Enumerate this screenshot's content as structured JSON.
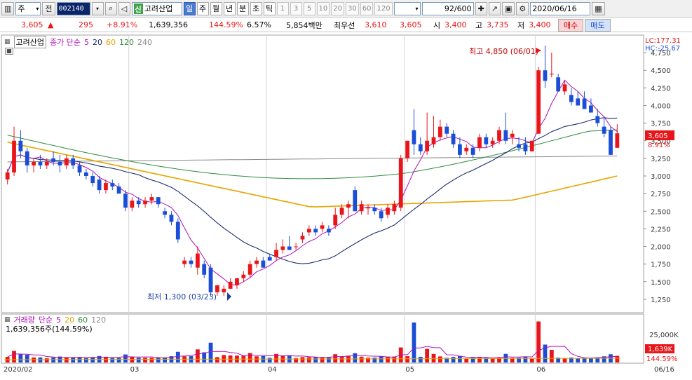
{
  "toolbar": {
    "market_a": "주",
    "market_b": "전",
    "code": "002140",
    "stock_name": "고려산업",
    "sin_badge": "신",
    "periods": [
      "일",
      "주",
      "월",
      "년",
      "분",
      "초",
      "틱"
    ],
    "active_period": "일",
    "numbers": [
      "1",
      "3",
      "5",
      "10",
      "20",
      "30",
      "60",
      "120"
    ],
    "count": "92/600",
    "date": "2020/06/16"
  },
  "quote": {
    "price": "3,605",
    "change_arrow": "▲",
    "change": "295",
    "change_pct": "+8.91%",
    "volume": "1,639,356",
    "volume_ratio": "144.59%",
    "turnover": "6.57%",
    "amount": "5,854백만",
    "best_ask_label": "최우선",
    "best_ask": "3,610",
    "best_bid": "3,605",
    "open_label": "시",
    "open": "3,400",
    "high_label": "고",
    "high": "3,735",
    "low_label": "저",
    "low": "3,400",
    "buy_label": "매수",
    "sell_label": "매도"
  },
  "price_panel": {
    "name": "고려산업",
    "ma_label": "종가 단순",
    "ma_periods": [
      "5",
      "20",
      "60",
      "120",
      "240"
    ],
    "lc": "LC:177.31",
    "hc": "HC:-25.67",
    "high_annot": "최고 4,850 (06/01)",
    "low_annot": "최저 1,300 (03/23)",
    "price_tag": "3,605",
    "pct_tag": "8.91%",
    "y_ticks": [
      "4,750",
      "4,500",
      "4,250",
      "4,000",
      "3,750",
      "3,500",
      "3,250",
      "3,000",
      "2,750",
      "2,500",
      "2,250",
      "2,000",
      "1,750",
      "1,500",
      "1,250"
    ]
  },
  "volume_panel": {
    "name": "거래량",
    "ma_label": "단순",
    "ma_periods": [
      "5",
      "20",
      "60",
      "120"
    ],
    "info": "1,639,356주(144.59%)",
    "y_tick": "25,000K",
    "vol_tag": "1,639K",
    "pct_tag": "144.59%"
  },
  "x_axis": {
    "labels": [
      "2020/02",
      "03",
      "04",
      "05",
      "06"
    ],
    "right_label": "06/16"
  },
  "colors": {
    "up": "#e8161a",
    "down": "#1b4ed6",
    "ma5": "#b012b8",
    "ma20": "#1c2c6e",
    "ma60": "#e6a600",
    "ma120": "#2e8b3e",
    "ma240": "#8a8a8a"
  },
  "chart_data": {
    "type": "candlestick",
    "series_note": "daily OHLC, approximate readings from the chart",
    "candles": [
      {
        "o": 2950,
        "h": 3100,
        "l": 2880,
        "c": 3050
      },
      {
        "o": 3050,
        "h": 3700,
        "l": 3000,
        "c": 3500
      },
      {
        "o": 3500,
        "h": 3650,
        "l": 3250,
        "c": 3350
      },
      {
        "o": 3350,
        "h": 3400,
        "l": 3050,
        "c": 3150
      },
      {
        "o": 3150,
        "h": 3250,
        "l": 3050,
        "c": 3200
      },
      {
        "o": 3200,
        "h": 3300,
        "l": 3100,
        "c": 3150
      },
      {
        "o": 3150,
        "h": 3250,
        "l": 3100,
        "c": 3200
      },
      {
        "o": 3250,
        "h": 3350,
        "l": 3150,
        "c": 3200
      },
      {
        "o": 3200,
        "h": 3300,
        "l": 3050,
        "c": 3150
      },
      {
        "o": 3150,
        "h": 3300,
        "l": 3100,
        "c": 3250
      },
      {
        "o": 3250,
        "h": 3300,
        "l": 3100,
        "c": 3150
      },
      {
        "o": 3150,
        "h": 3200,
        "l": 3000,
        "c": 3050
      },
      {
        "o": 3050,
        "h": 3100,
        "l": 2950,
        "c": 3000
      },
      {
        "o": 3000,
        "h": 3050,
        "l": 2850,
        "c": 2900
      },
      {
        "o": 2950,
        "h": 3000,
        "l": 2750,
        "c": 2800
      },
      {
        "o": 2800,
        "h": 2950,
        "l": 2750,
        "c": 2900
      },
      {
        "o": 2900,
        "h": 2950,
        "l": 2800,
        "c": 2850
      },
      {
        "o": 2850,
        "h": 2900,
        "l": 2750,
        "c": 2750
      },
      {
        "o": 2750,
        "h": 2800,
        "l": 2500,
        "c": 2550
      },
      {
        "o": 2550,
        "h": 2700,
        "l": 2500,
        "c": 2650
      },
      {
        "o": 2650,
        "h": 2700,
        "l": 2550,
        "c": 2600
      },
      {
        "o": 2600,
        "h": 2700,
        "l": 2550,
        "c": 2650
      },
      {
        "o": 2650,
        "h": 2750,
        "l": 2600,
        "c": 2700
      },
      {
        "o": 2700,
        "h": 2700,
        "l": 2550,
        "c": 2600
      },
      {
        "o": 2500,
        "h": 2550,
        "l": 2400,
        "c": 2450
      },
      {
        "o": 2450,
        "h": 2500,
        "l": 2300,
        "c": 2350
      },
      {
        "o": 2350,
        "h": 2400,
        "l": 2050,
        "c": 2100
      },
      {
        "o": 1750,
        "h": 1850,
        "l": 1700,
        "c": 1800
      },
      {
        "o": 1800,
        "h": 1850,
        "l": 1700,
        "c": 1750
      },
      {
        "o": 1700,
        "h": 2000,
        "l": 1600,
        "c": 1900
      },
      {
        "o": 1750,
        "h": 1800,
        "l": 1550,
        "c": 1600
      },
      {
        "o": 1700,
        "h": 1750,
        "l": 1300,
        "c": 1350
      },
      {
        "o": 1350,
        "h": 1400,
        "l": 1300,
        "c": 1450
      },
      {
        "o": 1350,
        "h": 1450,
        "l": 1300,
        "c": 1400
      },
      {
        "o": 1400,
        "h": 1550,
        "l": 1400,
        "c": 1500
      },
      {
        "o": 1450,
        "h": 1550,
        "l": 1400,
        "c": 1550
      },
      {
        "o": 1550,
        "h": 1650,
        "l": 1500,
        "c": 1600
      },
      {
        "o": 1600,
        "h": 1800,
        "l": 1550,
        "c": 1750
      },
      {
        "o": 1750,
        "h": 1850,
        "l": 1700,
        "c": 1800
      },
      {
        "o": 1800,
        "h": 1850,
        "l": 1700,
        "c": 1700
      },
      {
        "o": 1850,
        "h": 1900,
        "l": 1800,
        "c": 1800
      },
      {
        "o": 1850,
        "h": 2050,
        "l": 1800,
        "c": 1950
      },
      {
        "o": 1950,
        "h": 2100,
        "l": 1900,
        "c": 2000
      },
      {
        "o": 2000,
        "h": 2150,
        "l": 1950,
        "c": 1950
      },
      {
        "o": 2000,
        "h": 2050,
        "l": 1950,
        "c": 2000
      },
      {
        "o": 2100,
        "h": 2200,
        "l": 2050,
        "c": 2150
      },
      {
        "o": 2200,
        "h": 2300,
        "l": 2150,
        "c": 2250
      },
      {
        "o": 2250,
        "h": 2300,
        "l": 2150,
        "c": 2200
      },
      {
        "o": 2250,
        "h": 2350,
        "l": 2200,
        "c": 2300
      },
      {
        "o": 2250,
        "h": 2300,
        "l": 2150,
        "c": 2200
      },
      {
        "o": 2300,
        "h": 2550,
        "l": 2250,
        "c": 2450
      },
      {
        "o": 2450,
        "h": 2600,
        "l": 2400,
        "c": 2550
      },
      {
        "o": 2550,
        "h": 2650,
        "l": 2400,
        "c": 2600
      },
      {
        "o": 2800,
        "h": 2850,
        "l": 2500,
        "c": 2500
      },
      {
        "o": 2500,
        "h": 2650,
        "l": 2450,
        "c": 2600
      },
      {
        "o": 2550,
        "h": 2600,
        "l": 2450,
        "c": 2550
      },
      {
        "o": 2550,
        "h": 2600,
        "l": 2450,
        "c": 2500
      },
      {
        "o": 2500,
        "h": 2550,
        "l": 2350,
        "c": 2400
      },
      {
        "o": 2450,
        "h": 2600,
        "l": 2400,
        "c": 2550
      },
      {
        "o": 2500,
        "h": 2650,
        "l": 2450,
        "c": 2600
      },
      {
        "o": 2550,
        "h": 3300,
        "l": 2500,
        "c": 3250
      },
      {
        "o": 3250,
        "h": 3500,
        "l": 3200,
        "c": 3500
      },
      {
        "o": 3650,
        "h": 3950,
        "l": 3300,
        "c": 3450
      },
      {
        "o": 3450,
        "h": 3550,
        "l": 3300,
        "c": 3350
      },
      {
        "o": 3350,
        "h": 3900,
        "l": 3300,
        "c": 3500
      },
      {
        "o": 3450,
        "h": 3850,
        "l": 3400,
        "c": 3550
      },
      {
        "o": 3550,
        "h": 3800,
        "l": 3500,
        "c": 3700
      },
      {
        "o": 3700,
        "h": 3750,
        "l": 3550,
        "c": 3600
      },
      {
        "o": 3600,
        "h": 3650,
        "l": 3400,
        "c": 3450
      },
      {
        "o": 3450,
        "h": 3550,
        "l": 3250,
        "c": 3300
      },
      {
        "o": 3350,
        "h": 3450,
        "l": 3300,
        "c": 3400
      },
      {
        "o": 3400,
        "h": 3450,
        "l": 3250,
        "c": 3300
      },
      {
        "o": 3400,
        "h": 3600,
        "l": 3350,
        "c": 3550
      },
      {
        "o": 3550,
        "h": 3600,
        "l": 3400,
        "c": 3450
      },
      {
        "o": 3450,
        "h": 3550,
        "l": 3400,
        "c": 3500
      },
      {
        "o": 3500,
        "h": 3700,
        "l": 3450,
        "c": 3650
      },
      {
        "o": 3650,
        "h": 3900,
        "l": 3450,
        "c": 3500
      },
      {
        "o": 3550,
        "h": 3650,
        "l": 3450,
        "c": 3600
      },
      {
        "o": 3450,
        "h": 3550,
        "l": 3350,
        "c": 3400
      },
      {
        "o": 3450,
        "h": 3550,
        "l": 3300,
        "c": 3350
      },
      {
        "o": 3350,
        "h": 3500,
        "l": 3350,
        "c": 3500
      },
      {
        "o": 3600,
        "h": 4550,
        "l": 3600,
        "c": 4500
      },
      {
        "o": 4500,
        "h": 4850,
        "l": 4250,
        "c": 4350
      },
      {
        "o": 4450,
        "h": 4750,
        "l": 4400,
        "c": 4450
      },
      {
        "o": 4400,
        "h": 4450,
        "l": 4200,
        "c": 4200
      },
      {
        "o": 4200,
        "h": 4350,
        "l": 4150,
        "c": 4300
      },
      {
        "o": 4150,
        "h": 4250,
        "l": 4000,
        "c": 4050
      },
      {
        "o": 4100,
        "h": 4200,
        "l": 4000,
        "c": 4000
      },
      {
        "o": 4100,
        "h": 4200,
        "l": 3950,
        "c": 3950
      },
      {
        "o": 4000,
        "h": 4100,
        "l": 3900,
        "c": 3900
      },
      {
        "o": 3850,
        "h": 3950,
        "l": 3700,
        "c": 3750
      },
      {
        "o": 3700,
        "h": 3850,
        "l": 3550,
        "c": 3600
      },
      {
        "o": 3650,
        "h": 3700,
        "l": 3300,
        "c": 3300
      },
      {
        "o": 3400,
        "h": 3735,
        "l": 3400,
        "c": 3605
      }
    ],
    "ylim": [
      1100,
      4950
    ]
  }
}
